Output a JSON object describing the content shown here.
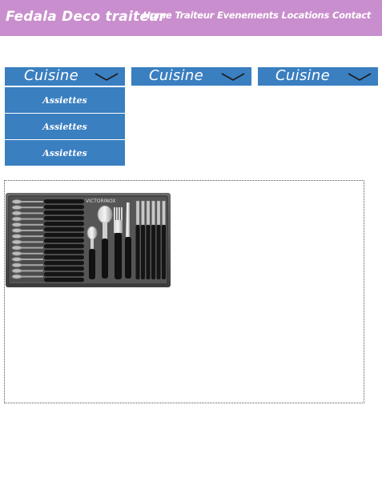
{
  "header": {
    "brand": "Fedala Deco traiteur",
    "nav": [
      "Home",
      "Traiteur",
      "Evenements",
      "Locations",
      "Contact"
    ],
    "background": "#c98ecd"
  },
  "menus": [
    {
      "label": "Cuisine",
      "icon": "chevron-down-icon"
    },
    {
      "label": "Cuisine",
      "icon": "chevron-down-icon"
    },
    {
      "label": "Cuisine",
      "icon": "chevron-down-icon"
    }
  ],
  "submenu": {
    "items": [
      "Assiettes",
      "Assiettes",
      "Assiettes"
    ]
  },
  "product": {
    "brand_mark": "VICTORINOX",
    "icon": "cutlery-set-image"
  },
  "colors": {
    "menu": "#3a7fc0",
    "text": "#ffffff"
  }
}
